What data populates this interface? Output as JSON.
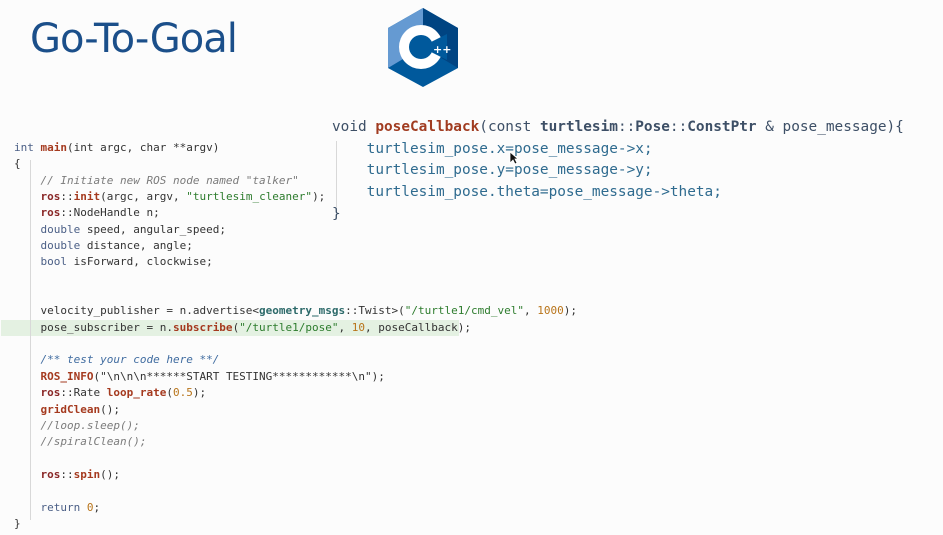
{
  "slide": {
    "title": "Go-To-Goal"
  },
  "logo": {
    "name": "cpp-logo-icon",
    "text": "++",
    "colors": {
      "hex_light": "#659ad2",
      "hex_mid": "#00599c",
      "hex_dark": "#004482"
    }
  },
  "right_code": {
    "l1": {
      "a": "void ",
      "b": "poseCallback",
      "c": "(",
      "d": "const ",
      "e": "turtlesim",
      "f": "::",
      "g": "Pose",
      "h": "::",
      "i": "ConstPtr",
      "j": " & pose_message){"
    },
    "l2": "turtlesim_pose.x=pose_message->x;",
    "l3": "turtlesim_pose.y=pose_message->y;",
    "l4": "turtlesim_pose.theta=pose_message->theta;",
    "l5": "}"
  },
  "left_code": {
    "l1": {
      "a": "int ",
      "b": "main",
      "c": "(int argc, char **argv)"
    },
    "l2": "{",
    "l3": "// Initiate new ROS node named \"talker\"",
    "l4": {
      "a": "ros",
      "b": "::",
      "c": "init",
      "d": "(argc, argv, ",
      "e": "\"turtlesim_cleaner\"",
      "f": ");"
    },
    "l5": {
      "a": "ros",
      "b": "::NodeHandle n;"
    },
    "l6": {
      "a": "double",
      "b": " speed, angular_speed;"
    },
    "l7": {
      "a": "double",
      "b": " distance, angle;"
    },
    "l8": {
      "a": "bool",
      "b": " isForward, clockwise;"
    },
    "l9": {
      "a": "velocity_publisher = n.advertise<",
      "b": "geometry_msgs",
      "c": "::Twist>(",
      "d": "\"/turtle1/cmd_vel\"",
      "e": ", ",
      "f": "1000",
      "g": ");"
    },
    "l10": {
      "a": "pose_subscriber = n.",
      "b": "subscribe",
      "c": "(",
      "d": "\"/turtle1/pose\"",
      "e": ", ",
      "f": "10",
      "g": ", poseCallback);"
    },
    "l11": "/** test your code here **/",
    "l12": {
      "a": "ROS_INFO",
      "b": "(",
      "c": "\"\\n\\n\\n******START TESTING************\\n\"",
      "d": ");"
    },
    "l13": {
      "a": "ros",
      "b": "::Rate ",
      "c": "loop_rate",
      "d": "(",
      "e": "0.5",
      "f": ");"
    },
    "l14": {
      "a": "gridClean",
      "b": "();"
    },
    "l15": "//loop.sleep();",
    "l16": "//spiralClean();",
    "l17": {
      "a": "ros",
      "b": "::",
      "c": "spin",
      "d": "();"
    },
    "l18": {
      "a": "return ",
      "b": "0",
      "c": ";"
    },
    "l19": "}"
  }
}
